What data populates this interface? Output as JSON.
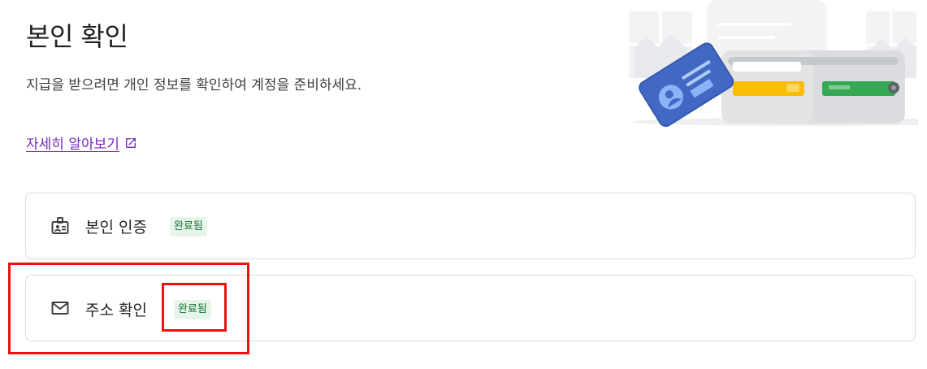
{
  "page": {
    "title": "본인 확인",
    "description": "지급을 받으려면 개인 정보를 확인하여 계정을 준비하세요.",
    "learn_more": "자세히 알아보기",
    "learn_more_icon": "external-link-icon"
  },
  "verification_items": [
    {
      "label": "본인 인증",
      "status": "완료됨",
      "icon": "id-badge-icon"
    },
    {
      "label": "주소 확인",
      "status": "완료됨",
      "icon": "mail-icon"
    }
  ],
  "colors": {
    "link": "#7627bb",
    "badge_bg": "#e6f4ea",
    "badge_text": "#137333",
    "highlight": "#ee1111",
    "card_border": "#dadce0"
  }
}
